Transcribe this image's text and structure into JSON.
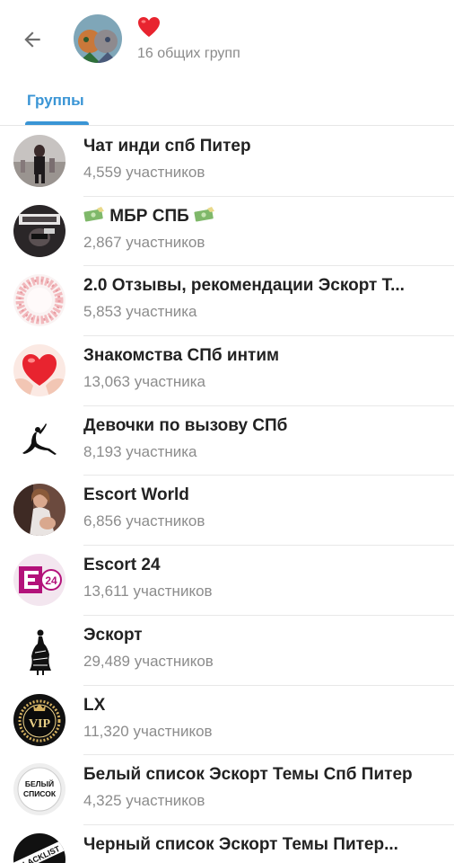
{
  "header": {
    "emoji": "❤️",
    "subtitle": "16 общих групп"
  },
  "tabs": [
    {
      "label": "Группы",
      "active": true
    }
  ],
  "colors": {
    "accent": "#3a95d5",
    "subtitle": "#8a8a8a",
    "divider": "#e8e8e8"
  },
  "groups": [
    {
      "name": "Чат инди спб Питер",
      "members": "4,559 участников",
      "avatar_icon": "photo-street-avatar"
    },
    {
      "prefix_icon": "money-icon",
      "name": "МБР СПБ",
      "suffix_icon": "money-icon",
      "members": "2,867 участников",
      "avatar_icon": "photo-dark-avatar"
    },
    {
      "name": "2.0 Отзывы, рекомендации Эскорт Т...",
      "members": "5,853 участника",
      "avatar_icon": "rose-wreath-avatar"
    },
    {
      "name": "Знакомства СПб интим",
      "members": "13,063 участника",
      "avatar_icon": "heart-hands-avatar"
    },
    {
      "name": "Девочки по вызову СПб",
      "members": "8,193 участника",
      "avatar_icon": "silhouette-avatar"
    },
    {
      "name": "Escort World",
      "members": "6,856 участников",
      "avatar_icon": "photo-woman-avatar"
    },
    {
      "name": "Escort 24",
      "members": "13,611 участников",
      "avatar_icon": "e24-logo-avatar",
      "logo_text": "E24"
    },
    {
      "name": "Эскорт",
      "members": "29,489 участников",
      "avatar_icon": "dress-silhouette-avatar"
    },
    {
      "name": "LX",
      "members": "11,320 участников",
      "avatar_icon": "vip-badge-avatar",
      "logo_text": "VIP"
    },
    {
      "name": "Белый список Эскорт Темы Спб Питер",
      "members": "4,325 участников",
      "avatar_icon": "white-list-avatar",
      "logo_text": "БЕЛЫЙ СПИСОК"
    },
    {
      "name": "Черный список Эскорт Темы Питер...",
      "members": "",
      "avatar_icon": "blacklist-avatar",
      "logo_text": "BLACKLIST"
    }
  ]
}
